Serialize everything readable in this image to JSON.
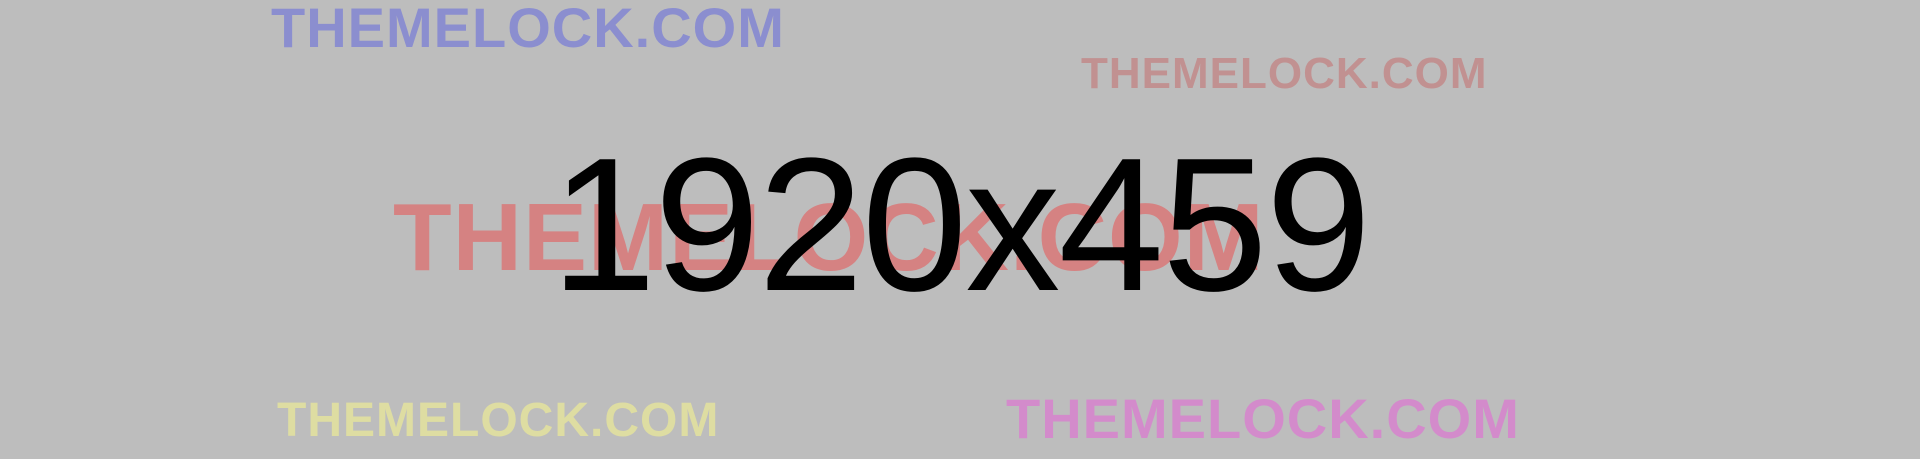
{
  "placeholder": {
    "dimensions_text": "1920x459",
    "background_color": "#bdbdbd",
    "text_color": "#000000"
  },
  "watermarks": [
    {
      "text": "THEMELOCK.COM",
      "color": "#7b7fd6"
    },
    {
      "text": "THEMELOCK.COM",
      "color": "#c47f7f"
    },
    {
      "text": "THEMELOCK.COM",
      "color": "#e06a6a"
    },
    {
      "text": "THEMELOCK.COM",
      "color": "#e7e59c"
    },
    {
      "text": "THEMELOCK.COM",
      "color": "#d97fcf"
    }
  ]
}
